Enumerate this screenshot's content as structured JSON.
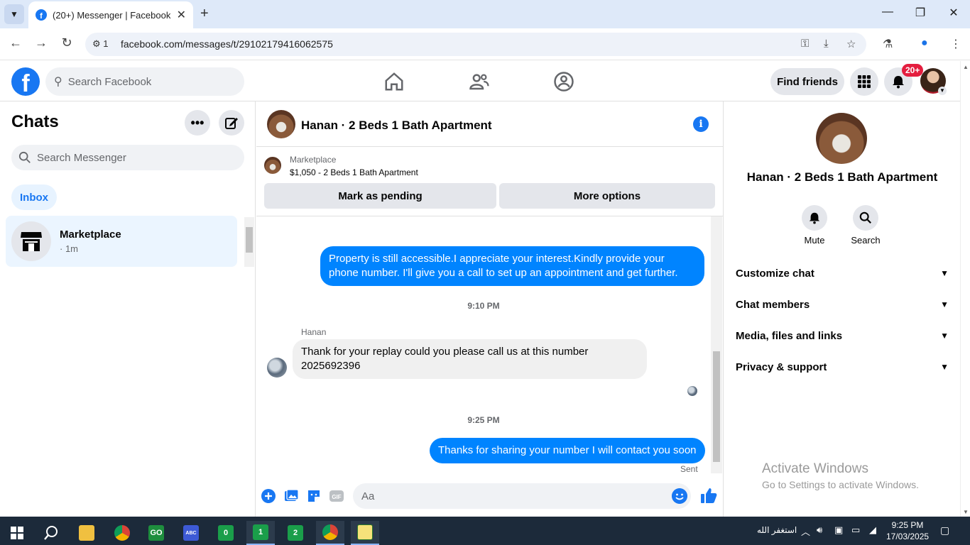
{
  "browser": {
    "tab_title": "(20+) Messenger | Facebook",
    "site_info_count": "1",
    "url": "facebook.com/messages/t/29102179416062575"
  },
  "fb_header": {
    "search_placeholder": "Search Facebook",
    "find_friends": "Find friends",
    "notification_badge": "20+"
  },
  "chats": {
    "title": "Chats",
    "search_placeholder": "Search Messenger",
    "inbox_label": "Inbox",
    "conversations": [
      {
        "name": "Marketplace",
        "time": "· 1m"
      }
    ]
  },
  "conversation": {
    "title": "Hanan · 2 Beds 1 Bath Apartment",
    "marketplace_label": "Marketplace",
    "listing": "$1,050 - 2 Beds 1 Bath Apartment",
    "mark_pending": "Mark as pending",
    "more_options": "More options",
    "messages": [
      {
        "text": "Property is still accessible.I appreciate your interest.Kindly provide your phone number. I'll give you a call to set up an appointment and get further."
      },
      {
        "timestamp": "9:10 PM"
      },
      {
        "sender": "Hanan",
        "text": "Thank for your replay could you please call us at this number 2025692396"
      },
      {
        "timestamp": "9:25 PM"
      },
      {
        "text": "Thanks for sharing your number I will contact you soon",
        "status": "Sent"
      }
    ],
    "input_placeholder": "Aa"
  },
  "info_panel": {
    "title": "Hanan · 2 Beds 1 Bath Apartment",
    "actions": [
      "Mute",
      "Search"
    ],
    "sections": [
      "Customize chat",
      "Chat members",
      "Media, files and links",
      "Privacy & support"
    ]
  },
  "watermark": {
    "line1": "Activate Windows",
    "line2": "Go to Settings to activate Windows."
  },
  "taskbar": {
    "tray_text": "استغفر الله",
    "time": "9:25 PM",
    "date": "17/03/2025",
    "apps": [
      "1",
      "2",
      "0"
    ]
  },
  "colors": {
    "facebook_blue": "#1877f2",
    "messenger_blue": "#0084ff",
    "badge_red": "#e41e3f"
  }
}
